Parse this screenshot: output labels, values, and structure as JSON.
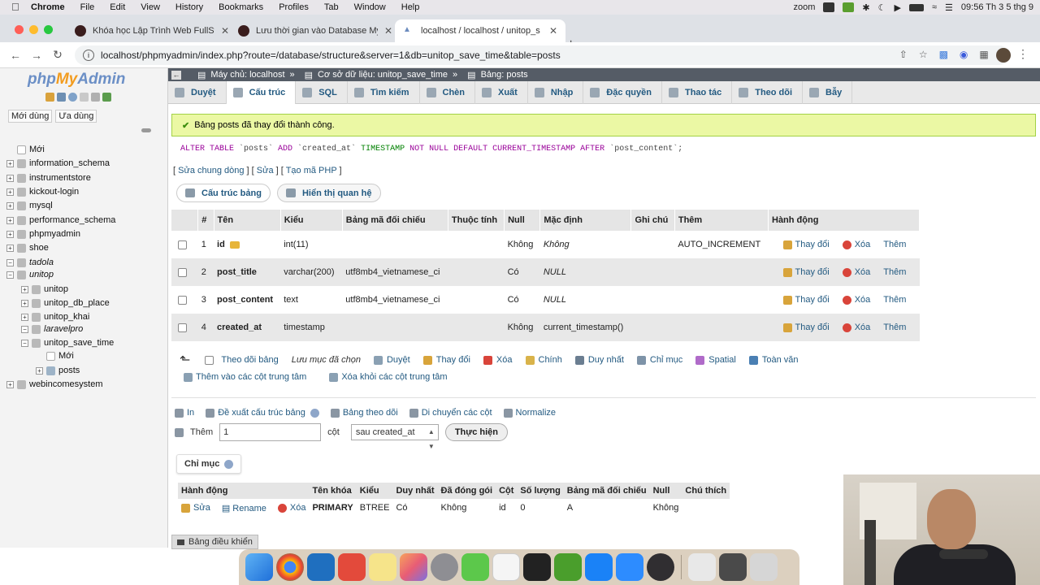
{
  "menubar": {
    "items": [
      "Chrome",
      "File",
      "Edit",
      "View",
      "History",
      "Bookmarks",
      "Profiles",
      "Tab",
      "Window",
      "Help"
    ],
    "zoom": "zoom",
    "clock": "09:56 Th 3 5 thg 9"
  },
  "tabs": [
    {
      "title": "Khóa học Lập Trình Web FullSt",
      "active": false
    },
    {
      "title": "Lưu thời gian vào Database My",
      "active": false
    },
    {
      "title": "localhost / localhost / unitop_s",
      "active": true
    }
  ],
  "address": {
    "url": "localhost/phpmyadmin/index.php?route=/database/structure&server=1&db=unitop_save_time&table=posts"
  },
  "sidebar": {
    "logo_php": "php",
    "logo_my": "My",
    "logo_admin": "Admin",
    "tabs": [
      "Mới dùng",
      "Ưa dùng"
    ],
    "tree": [
      {
        "label": "Mới",
        "level": 0,
        "kind": "new"
      },
      {
        "label": "information_schema",
        "level": 0,
        "kind": "db"
      },
      {
        "label": "instrumentstore",
        "level": 0,
        "kind": "db"
      },
      {
        "label": "kickout-login",
        "level": 0,
        "kind": "db"
      },
      {
        "label": "mysql",
        "level": 0,
        "kind": "db"
      },
      {
        "label": "performance_schema",
        "level": 0,
        "kind": "db"
      },
      {
        "label": "phpmyadmin",
        "level": 0,
        "kind": "db"
      },
      {
        "label": "shoe",
        "level": 0,
        "kind": "db"
      },
      {
        "label": "tadola",
        "level": 0,
        "kind": "group"
      },
      {
        "label": "unitop",
        "level": 0,
        "kind": "group"
      },
      {
        "label": "unitop",
        "level": 1,
        "kind": "db"
      },
      {
        "label": "unitop_db_place",
        "level": 1,
        "kind": "db"
      },
      {
        "label": "unitop_khai",
        "level": 1,
        "kind": "db"
      },
      {
        "label": "laravelpro",
        "level": 1,
        "kind": "group"
      },
      {
        "label": "unitop_save_time",
        "level": 1,
        "kind": "db"
      },
      {
        "label": "Mới",
        "level": 2,
        "kind": "new"
      },
      {
        "label": "posts",
        "level": 2,
        "kind": "table"
      },
      {
        "label": "webincomesystem",
        "level": 0,
        "kind": "db"
      }
    ]
  },
  "breadcrumb": {
    "server": "Máy chủ: localhost",
    "database": "Cơ sở dữ liệu: unitop_save_time",
    "table": "Bảng: posts"
  },
  "topmenu": [
    "Duyệt",
    "Cấu trúc",
    "SQL",
    "Tìm kiếm",
    "Chèn",
    "Xuất",
    "Nhập",
    "Đặc quyền",
    "Thao tác",
    "Theo dõi",
    "Bẫy"
  ],
  "message": {
    "success": "Bảng posts đã thay đổi thành công.",
    "sql": {
      "alter": "ALTER TABLE",
      "t1": " `posts` ",
      "add": "ADD",
      "t2": " `created_at` ",
      "type": "TIMESTAMP",
      "nn": "NOT NULL DEFAULT",
      "t3": " ",
      "cur": "CURRENT_TIMESTAMP",
      "t4": " ",
      "after": "AFTER",
      "t5": " `post_content`;"
    },
    "links": {
      "edit_inline": "Sửa chung dòng",
      "edit": "Sửa",
      "php": "Tạo mã PHP"
    }
  },
  "subtabs": [
    "Cấu trúc bảng",
    "Hiển thị quan hệ"
  ],
  "structure": {
    "headers": [
      "#",
      "Tên",
      "Kiểu",
      "Bảng mã đối chiếu",
      "Thuộc tính",
      "Null",
      "Mặc định",
      "Ghi chú",
      "Thêm",
      "Hành động"
    ],
    "rows": [
      {
        "num": "1",
        "name": "id",
        "type": "int(11)",
        "collation": "",
        "attr": "",
        "null": "Không",
        "default": "Không",
        "comment": "",
        "extra": "AUTO_INCREMENT"
      },
      {
        "num": "2",
        "name": "post_title",
        "type": "varchar(200)",
        "collation": "utf8mb4_vietnamese_ci",
        "attr": "",
        "null": "Có",
        "default": "NULL",
        "comment": "",
        "extra": ""
      },
      {
        "num": "3",
        "name": "post_content",
        "type": "text",
        "collation": "utf8mb4_vietnamese_ci",
        "attr": "",
        "null": "Có",
        "default": "NULL",
        "comment": "",
        "extra": ""
      },
      {
        "num": "4",
        "name": "created_at",
        "type": "timestamp",
        "collation": "",
        "attr": "",
        "null": "Không",
        "default": "current_timestamp()",
        "comment": "",
        "extra": ""
      }
    ],
    "actions": {
      "change": "Thay đổi",
      "drop": "Xóa",
      "more": "Thêm"
    }
  },
  "bulk": {
    "check_all": "Theo dõi bảng",
    "with_selected": "Lưu mục đã chọn",
    "items": [
      "Duyệt",
      "Thay đổi",
      "Xóa",
      "Chính",
      "Duy nhất",
      "Chỉ mục",
      "Spatial",
      "Toàn văn"
    ],
    "items2": [
      "Thêm vào các cột trung tâm",
      "Xóa khỏi các cột trung tâm"
    ]
  },
  "tools": {
    "items": [
      "In",
      "Đề xuất cấu trúc bảng",
      "Bảng theo dõi",
      "Di chuyển các cột",
      "Normalize"
    ],
    "add_label": "Thêm",
    "add_value": "1",
    "col_label": "cột",
    "position": "sau created_at",
    "go": "Thực hiện"
  },
  "indexes": {
    "legend": "Chỉ mục",
    "headers": [
      "Hành động",
      "Tên khóa",
      "Kiểu",
      "Duy nhất",
      "Đã đóng gói",
      "Cột",
      "Số lượng",
      "Bảng mã đối chiếu",
      "Null",
      "Chú thích"
    ],
    "row": {
      "edit": "Sửa",
      "rename": "Rename",
      "drop": "Xóa",
      "key": "PRIMARY",
      "type": "BTREE",
      "unique": "Có",
      "packed": "Không",
      "column": "id",
      "cardinality": "0",
      "collation": "A",
      "null": "Không",
      "comment": ""
    }
  },
  "console": {
    "label": "Bảng điều khiển"
  },
  "colors": {
    "link": "#235a81",
    "success_bg": "#ebf8a4",
    "crumb_bg": "#555c66"
  }
}
